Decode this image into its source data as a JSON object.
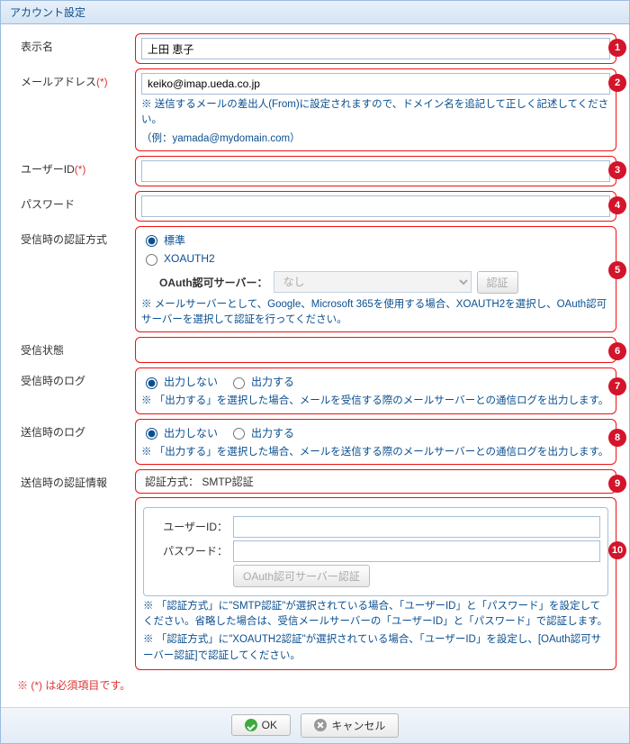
{
  "title": "アカウント設定",
  "labels": {
    "display_name": "表示名",
    "email": "メールアドレス",
    "req": "(*)",
    "user_id": "ユーザーID",
    "password": "パスワード",
    "recv_auth": "受信時の認証方式",
    "recv_status": "受信状態",
    "recv_log": "受信時のログ",
    "send_log": "送信時のログ",
    "send_auth_info": "送信時の認証情報"
  },
  "values": {
    "display_name": "上田 恵子",
    "email": "keiko@imap.ueda.co.jp",
    "user_id": "",
    "password": ""
  },
  "email_hint1": "※ 送信するメールの差出人(From)に設定されますので、ドメイン名を追記して正しく記述してください。",
  "email_hint2": "（例：yamada@mydomain.com）",
  "recv_auth": {
    "opt_standard": "標準",
    "opt_xoauth2": "XOAUTH2",
    "oauth_server_label": "OAuth認可サーバー：",
    "oauth_server_value": "なし",
    "auth_btn": "認証",
    "hint": "※ メールサーバーとして、Google、Microsoft 365を使用する場合、XOAUTH2を選択し、OAuth認可サーバーを選択して認証を行ってください。"
  },
  "log": {
    "opt_no": "出力しない",
    "opt_yes": "出力する",
    "recv_hint": "※ 「出力する」を選択した場合、メールを受信する際のメールサーバーとの通信ログを出力します。",
    "send_hint": "※ 「出力する」を選択した場合、メールを送信する際のメールサーバーとの通信ログを出力します。"
  },
  "send_auth": {
    "method_line": "認証方式： SMTP認証",
    "user_id_label": "ユーザーID：",
    "password_label": "パスワード：",
    "oauth_btn": "OAuth認可サーバー認証",
    "hint1": "※ 「認証方式」に\"SMTP認証\"が選択されている場合、「ユーザーID」と「パスワード」を設定してください。省略した場合は、受信メールサーバーの「ユーザーID」と「パスワード」で認証します。",
    "hint2": "※ 「認証方式」に\"XOAUTH2認証\"が選択されている場合、「ユーザーID」を設定し、[OAuth認可サーバー認証]で認証してください。"
  },
  "footer_note": "※ (*) は必須項目です。",
  "buttons": {
    "ok": "OK",
    "cancel": "キャンセル"
  },
  "badges": [
    "1",
    "2",
    "3",
    "4",
    "5",
    "6",
    "7",
    "8",
    "9",
    "10"
  ]
}
